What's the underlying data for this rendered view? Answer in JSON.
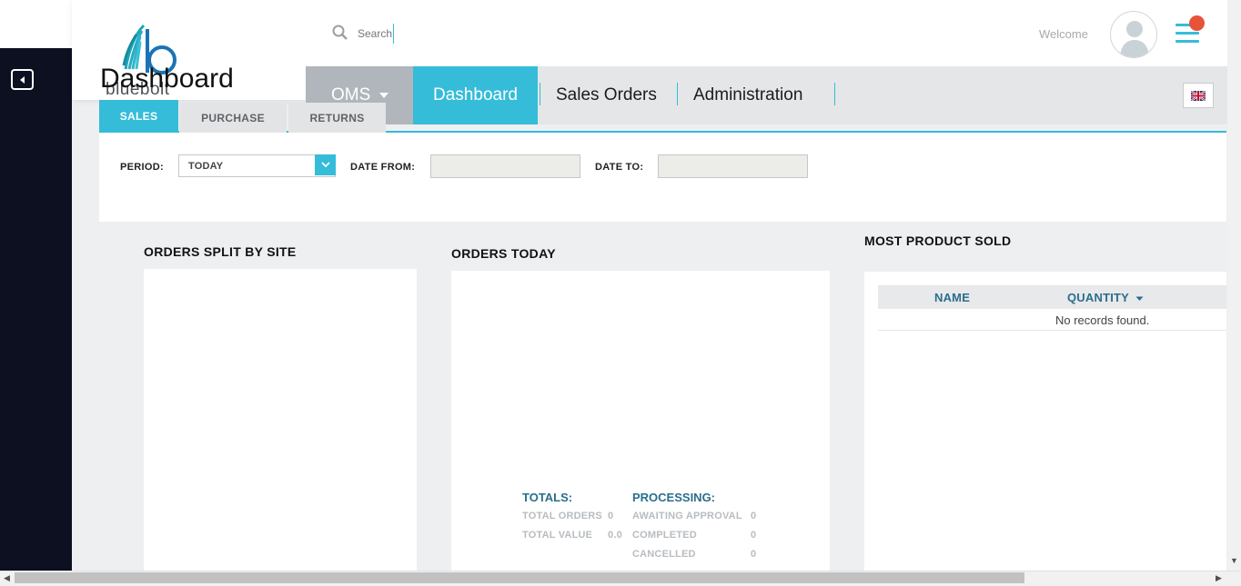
{
  "header": {
    "search_placeholder": "Search",
    "welcome": "Welcome"
  },
  "logo": {
    "name": "bluebolt"
  },
  "page_title": "Dashboard",
  "nav": {
    "oms": "OMS",
    "dashboard": "Dashboard",
    "sales_orders": "Sales Orders",
    "administration": "Administration"
  },
  "subtabs": {
    "sales": "SALES",
    "purchase": "PURCHASE",
    "returns": "RETURNS"
  },
  "filters": {
    "period_label": "PERIOD:",
    "period_value": "TODAY",
    "date_from_label": "DATE FROM:",
    "date_to_label": "DATE TO:"
  },
  "sections": {
    "orders_split": "ORDERS SPLIT BY SITE",
    "orders_today": "ORDERS TODAY",
    "most_sold": "MOST PRODUCT SOLD"
  },
  "product_table": {
    "columns": [
      "NAME",
      "QUANTITY"
    ],
    "empty_text": "No records found."
  },
  "totals": {
    "heading": "TOTALS:",
    "total_orders_label": "TOTAL ORDERS",
    "total_orders_value": "0",
    "total_value_label": "TOTAL VALUE",
    "total_value_value": "0.0"
  },
  "processing": {
    "heading": "PROCESSING:",
    "awaiting_label": "AWAITING APPROVAL",
    "awaiting_value": "0",
    "completed_label": "COMPLETED",
    "completed_value": "0",
    "cancelled_label": "CANCELLED",
    "cancelled_value": "0"
  },
  "colors": {
    "accent": "#35bcd8",
    "sidebar": "#0c1021",
    "notification": "#e7533a"
  }
}
